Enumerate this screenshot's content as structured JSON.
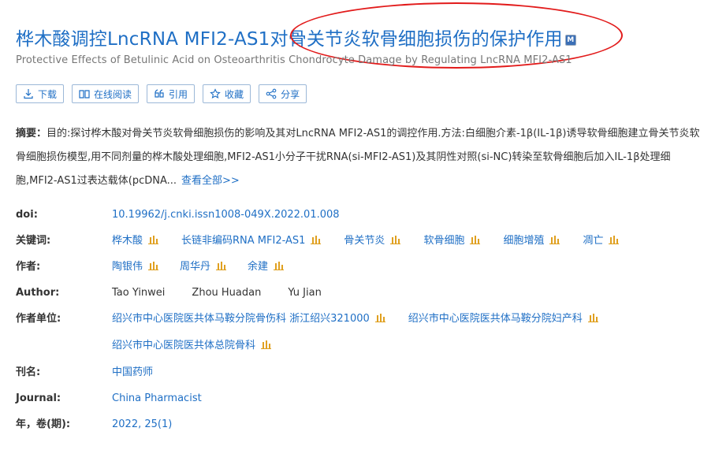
{
  "article": {
    "title": "桦木酸调控LncRNA MFI2-AS1对骨关节炎软骨细胞损伤的保护作用",
    "title_badge": "M",
    "subtitle": "Protective Effects of Betulinic Acid on Osteoarthritis Chondrocyte Damage by Regulating LncRNA MFI2-AS1"
  },
  "actions": [
    {
      "label": "下载",
      "icon": "download-icon"
    },
    {
      "label": "在线阅读",
      "icon": "book-icon"
    },
    {
      "label": "引用",
      "icon": "quote-icon"
    },
    {
      "label": "收藏",
      "icon": "star-icon"
    },
    {
      "label": "分享",
      "icon": "share-icon"
    }
  ],
  "abstract": {
    "label": "摘要：",
    "text": "目的:探讨桦木酸对骨关节炎软骨细胞损伤的影响及其对LncRNA MFI2-AS1的调控作用.方法:白细胞介素-1β(IL-1β)诱导软骨细胞建立骨关节炎软骨细胞损伤模型,用不同剂量的桦木酸处理细胞,MFI2-AS1小分子干扰RNA(si-MFI2-AS1)及其阴性对照(si-NC)转染至软骨细胞后加入IL-1β处理细胞,MFI2-AS1过表达载体(pcDNA...",
    "more": "查看全部>>"
  },
  "meta": {
    "doi_label": "doi:",
    "doi": "10.19962/j.cnki.issn1008-049X.2022.01.008",
    "keywords_label": "关键词:",
    "keywords": [
      "桦木酸",
      "长链非编码RNA MFI2-AS1",
      "骨关节炎",
      "软骨细胞",
      "细胞增殖",
      "凋亡"
    ],
    "authors_label": "作者:",
    "authors": [
      "陶银伟",
      "周华丹",
      "余建"
    ],
    "author_en_label": "Author:",
    "authors_en": [
      "Tao Yinwei",
      "Zhou Huadan",
      "Yu Jian"
    ],
    "affiliations_label": "作者单位:",
    "affiliations": [
      "绍兴市中心医院医共体马鞍分院骨伤科 浙江绍兴321000",
      "绍兴市中心医院医共体马鞍分院妇产科",
      "绍兴市中心医院医共体总院骨科"
    ],
    "journal_cn_label": "刊名:",
    "journal_cn": "中国药师",
    "journal_en_label": "Journal:",
    "journal_en": "China Pharmacist",
    "year_label": "年，卷(期):",
    "year": "2022, 25(1)"
  },
  "colors": {
    "link": "#1f6fc5",
    "annotation": "#e21b1b"
  }
}
